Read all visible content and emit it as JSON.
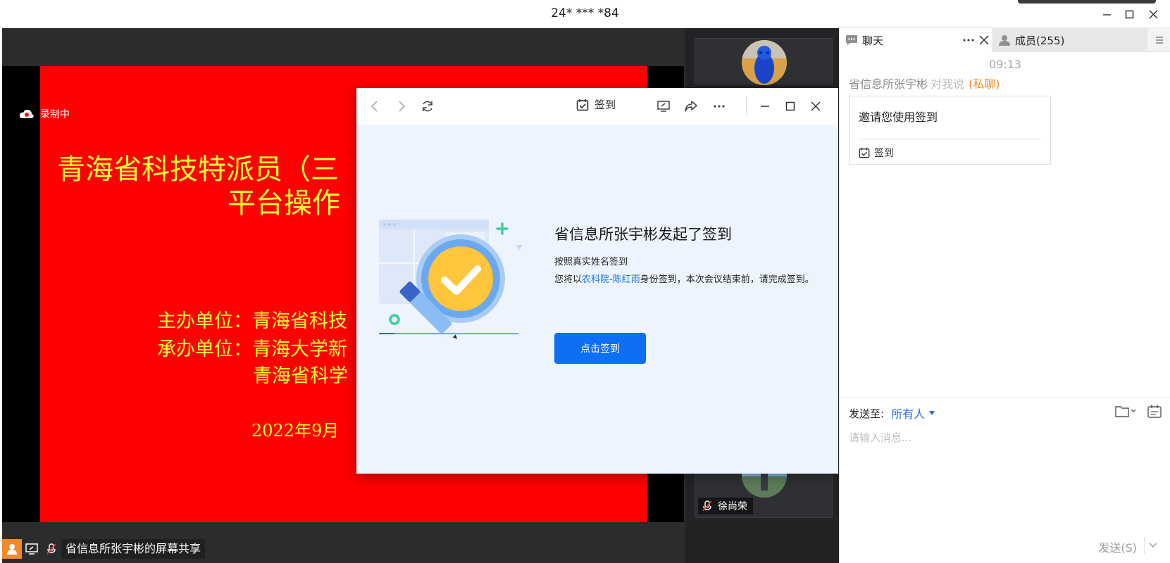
{
  "window": {
    "title": "24* *** *84"
  },
  "share": {
    "recording_label": "录制中",
    "status_text": "省信息所张宇彬的屏幕共享",
    "slide": {
      "title_line1": "青海省科技特派员（三",
      "title_line2": "平台操作",
      "host_line": "主办单位：青海省科技",
      "organizer_line": "承办单位：青海大学新",
      "organizer_line2": "青海省科学",
      "date_line": "2022年9月"
    }
  },
  "participants": [
    {
      "name": ""
    },
    {
      "name": "徐尚荣"
    }
  ],
  "signin_window": {
    "title": "签到",
    "heading": "省信息所张宇彬发起了签到",
    "subtitle": "按照真实姓名签到",
    "desc_prefix": "您将以",
    "desc_identity": "农科院-陈红雨",
    "desc_suffix": "身份签到，本次会议结束前，请完成签到。",
    "button_label": "点击签到"
  },
  "chat_panel": {
    "tab_chat": "聊天",
    "tab_members": "成员(255)",
    "time": "09:13",
    "sender_name": "省信息所张宇彬",
    "sender_to": "对我说",
    "private_tag": "(私聊)",
    "message": "邀请您使用签到",
    "card_action": "签到",
    "send_to_label": "发送至:",
    "recipient": "所有人",
    "input_placeholder": "请输入消息...",
    "send_button": "发送(S)"
  },
  "colors": {
    "slide_bg": "#ff0000",
    "slide_text": "#ffff33",
    "primary": "#0c6ff4",
    "private_tag": "#f08c1d",
    "link": "#1a73e8"
  }
}
